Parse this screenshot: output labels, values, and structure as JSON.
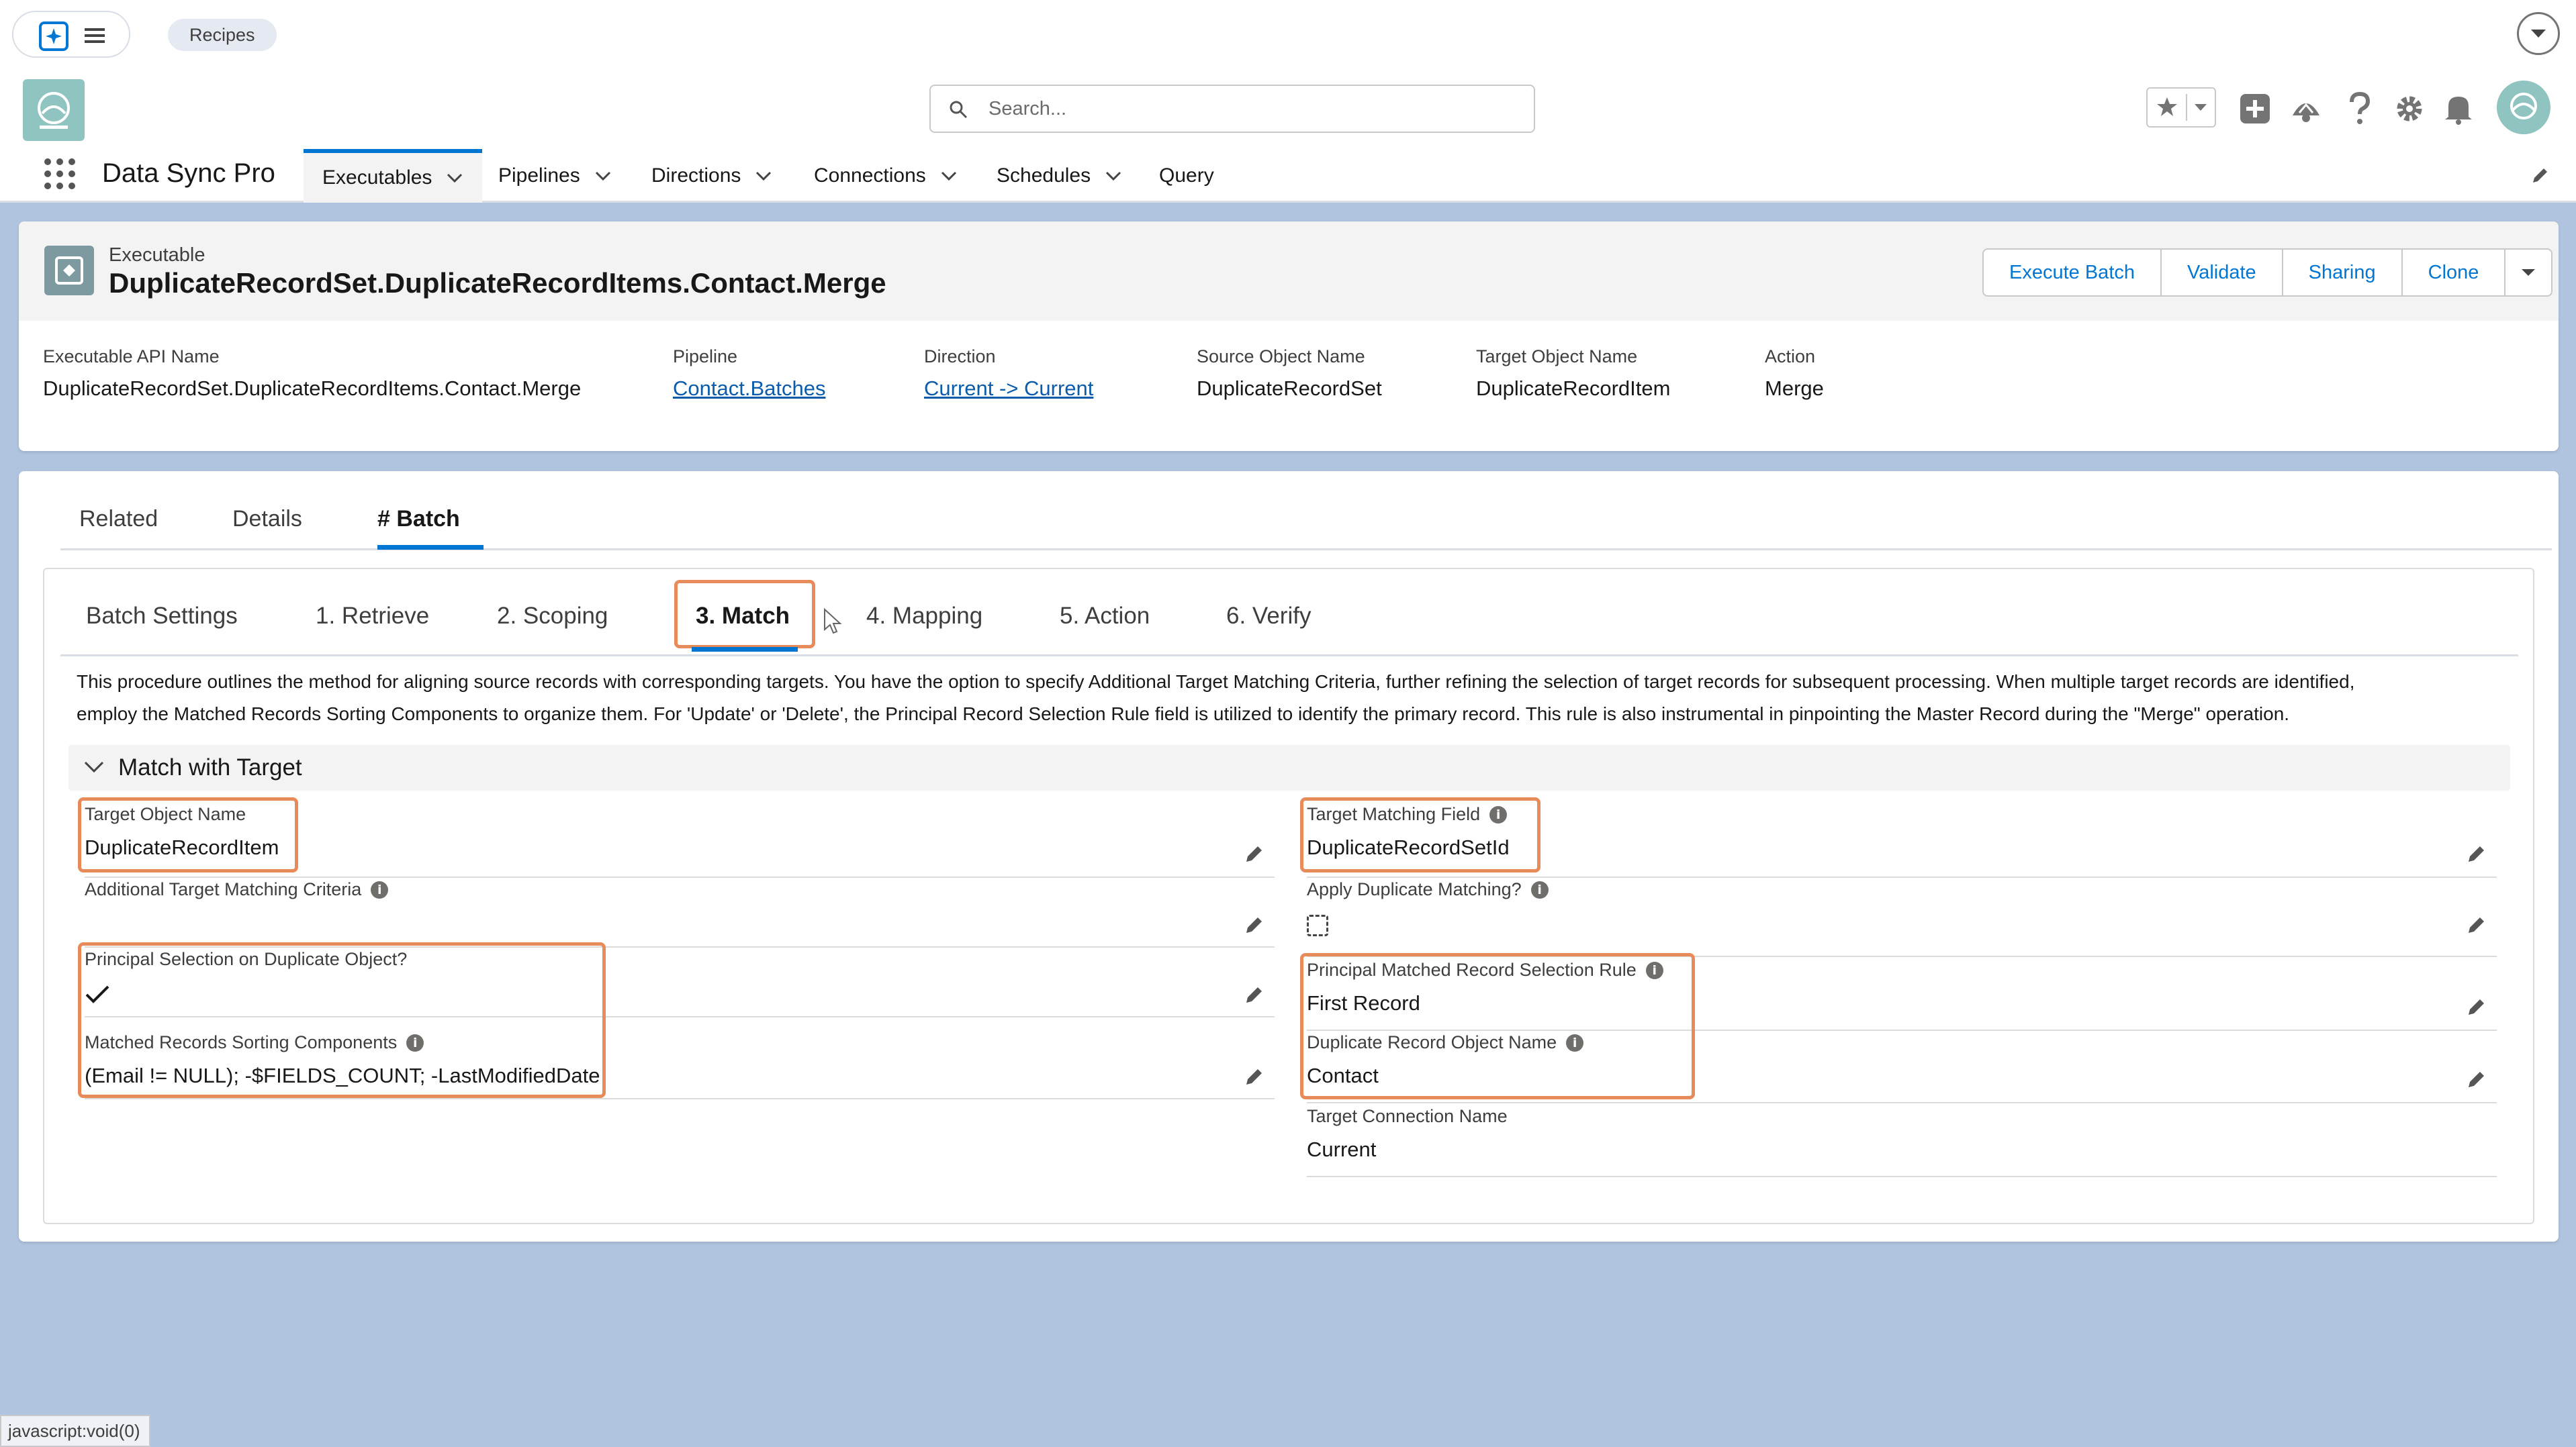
{
  "topbar": {
    "breadcrumb": "Recipes"
  },
  "header": {
    "search_placeholder": "Search...",
    "app_name": "Data Sync Pro",
    "nav": [
      {
        "label": "Executables",
        "active": true
      },
      {
        "label": "Pipelines"
      },
      {
        "label": "Directions"
      },
      {
        "label": "Connections"
      },
      {
        "label": "Schedules"
      },
      {
        "label": "Query"
      }
    ]
  },
  "record": {
    "type": "Executable",
    "title": "DuplicateRecordSet.DuplicateRecordItems.Contact.Merge",
    "buttons": [
      "Execute Batch",
      "Validate",
      "Sharing",
      "Clone"
    ],
    "highlights": [
      {
        "label": "Executable API Name",
        "value": "DuplicateRecordSet.DuplicateRecordItems.Contact.Merge"
      },
      {
        "label": "Pipeline",
        "value": "Contact.Batches"
      },
      {
        "label": "Direction",
        "value": "Current -> Current"
      },
      {
        "label": "Source Object Name",
        "value": "DuplicateRecordSet"
      },
      {
        "label": "Target Object Name",
        "value": "DuplicateRecordItem"
      },
      {
        "label": "Action",
        "value": "Merge"
      }
    ]
  },
  "tabs": [
    "Related",
    "Details",
    "# Batch"
  ],
  "subtabs": [
    "Batch Settings",
    "1. Retrieve",
    "2. Scoping",
    "3. Match",
    "4. Mapping",
    "5. Action",
    "6. Verify"
  ],
  "description_lines": [
    "This procedure outlines the method for aligning source records with corresponding targets. You have the option to specify Additional Target Matching Criteria, further refining the selection of target records for subsequent processing. When multiple target records are identified,",
    "employ the Matched Records Sorting Components to organize them. For 'Update' or 'Delete', the Principal Record Selection Rule field is utilized to identify the primary record. This rule is also instrumental in pinpointing the Master Record during the \"Merge\" operation."
  ],
  "section": {
    "title": "Match with Target"
  },
  "fields": {
    "target_object_name": {
      "label": "Target Object Name",
      "value": "DuplicateRecordItem"
    },
    "additional_criteria": {
      "label": "Additional Target Matching Criteria",
      "value": ""
    },
    "principal_selection": {
      "label": "Principal Selection on Duplicate Object?",
      "checked": true
    },
    "sorting_components": {
      "label": "Matched Records Sorting Components",
      "value": "(Email != NULL); -$FIELDS_COUNT; -LastModifiedDate"
    },
    "target_matching_field": {
      "label": "Target Matching Field",
      "value": "DuplicateRecordSetId"
    },
    "apply_duplicate_matching": {
      "label": "Apply Duplicate Matching?",
      "checked": false
    },
    "principal_rule": {
      "label": "Principal Matched Record Selection Rule",
      "value": "First Record"
    },
    "duplicate_object_name": {
      "label": "Duplicate Record Object Name",
      "value": "Contact"
    },
    "target_connection": {
      "label": "Target Connection Name",
      "value": "Current"
    }
  },
  "status_bar": "javascript:void(0)",
  "colors": {
    "brand": "#0176d3",
    "highlight": "#e88b5b",
    "background": "#b0c4df"
  }
}
